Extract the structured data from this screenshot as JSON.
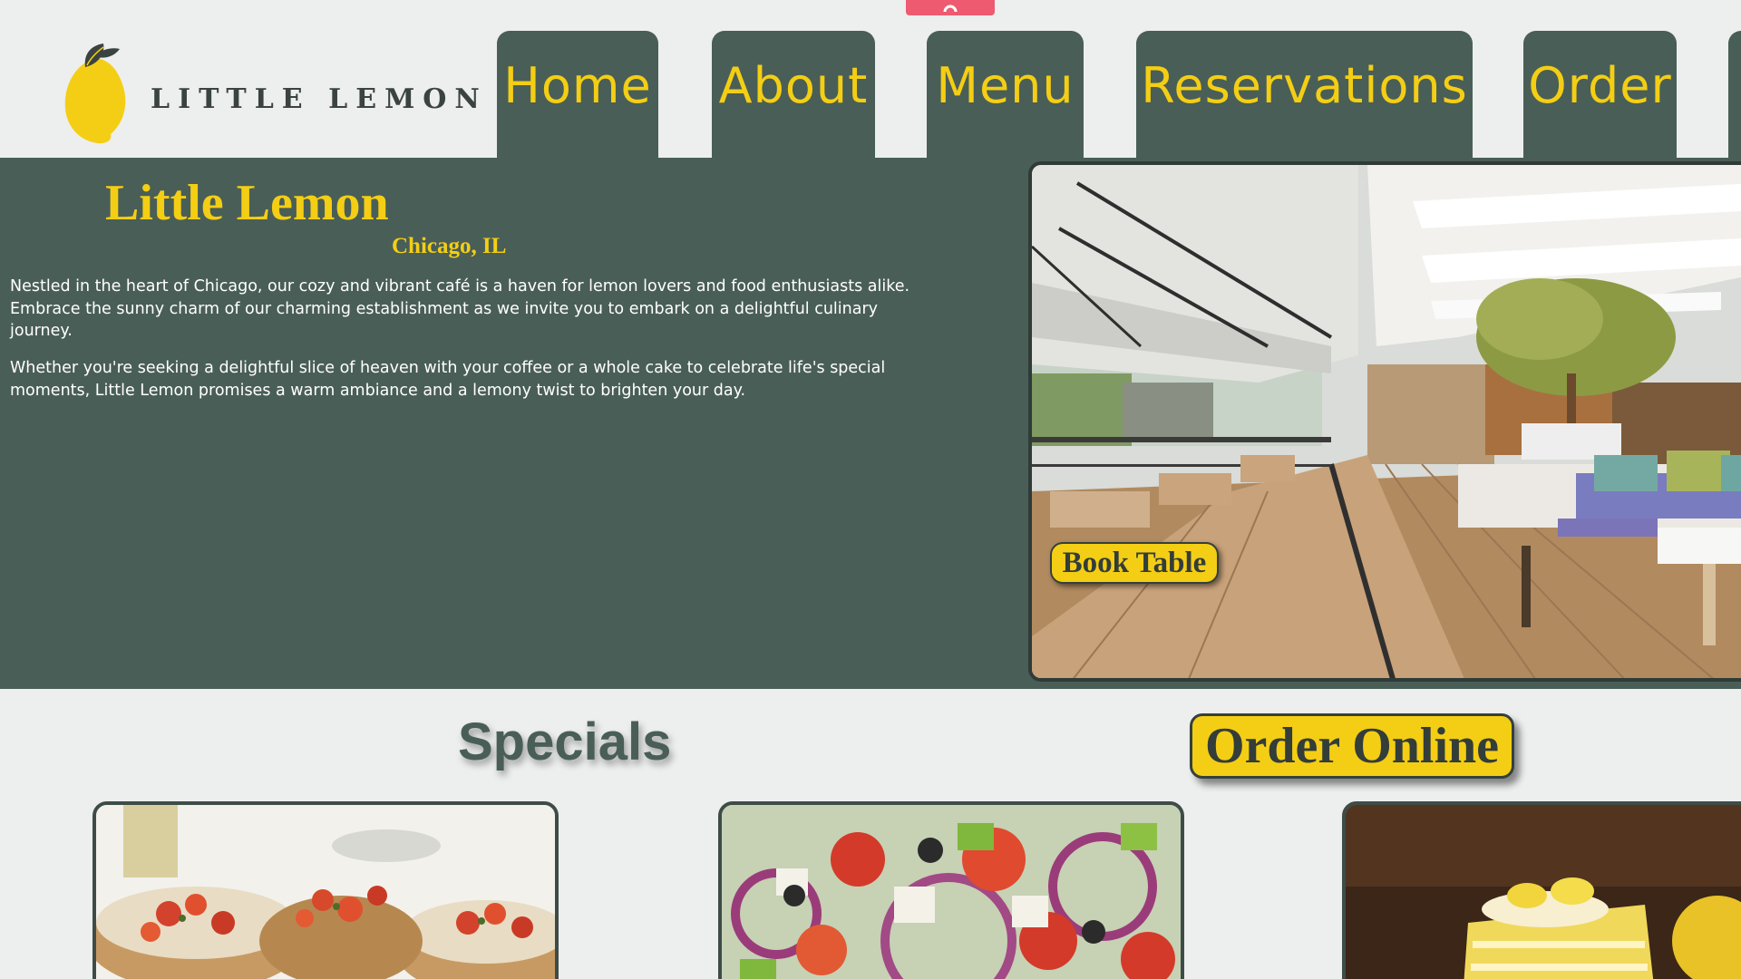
{
  "brand": {
    "name": "LITTLE LEMON"
  },
  "nav": {
    "items": [
      {
        "label": "Home"
      },
      {
        "label": "About"
      },
      {
        "label": "Menu"
      },
      {
        "label": "Reservations"
      },
      {
        "label": "Order"
      }
    ]
  },
  "hero": {
    "title": "Little Lemon",
    "subtitle": "Chicago, IL",
    "paragraphs": [
      "Nestled in the heart of Chicago, our cozy and vibrant café is a haven for lemon lovers and food enthusiasts alike. Embrace the sunny charm of our charming establishment as we invite you to embark on a delightful culinary journey.",
      "Whether you're seeking a delightful slice of heaven with your coffee or a whole cake to celebrate life's special moments, Little Lemon promises a warm ambiance and a lemony twist to brighten your day."
    ],
    "book_label": "Book Table"
  },
  "specials": {
    "title": "Specials",
    "order_label": "Order Online"
  },
  "colors": {
    "primary_green": "#495e57",
    "primary_yellow": "#f4ce14",
    "background": "#edeeee",
    "accent_pink": "#ee5a6f"
  }
}
